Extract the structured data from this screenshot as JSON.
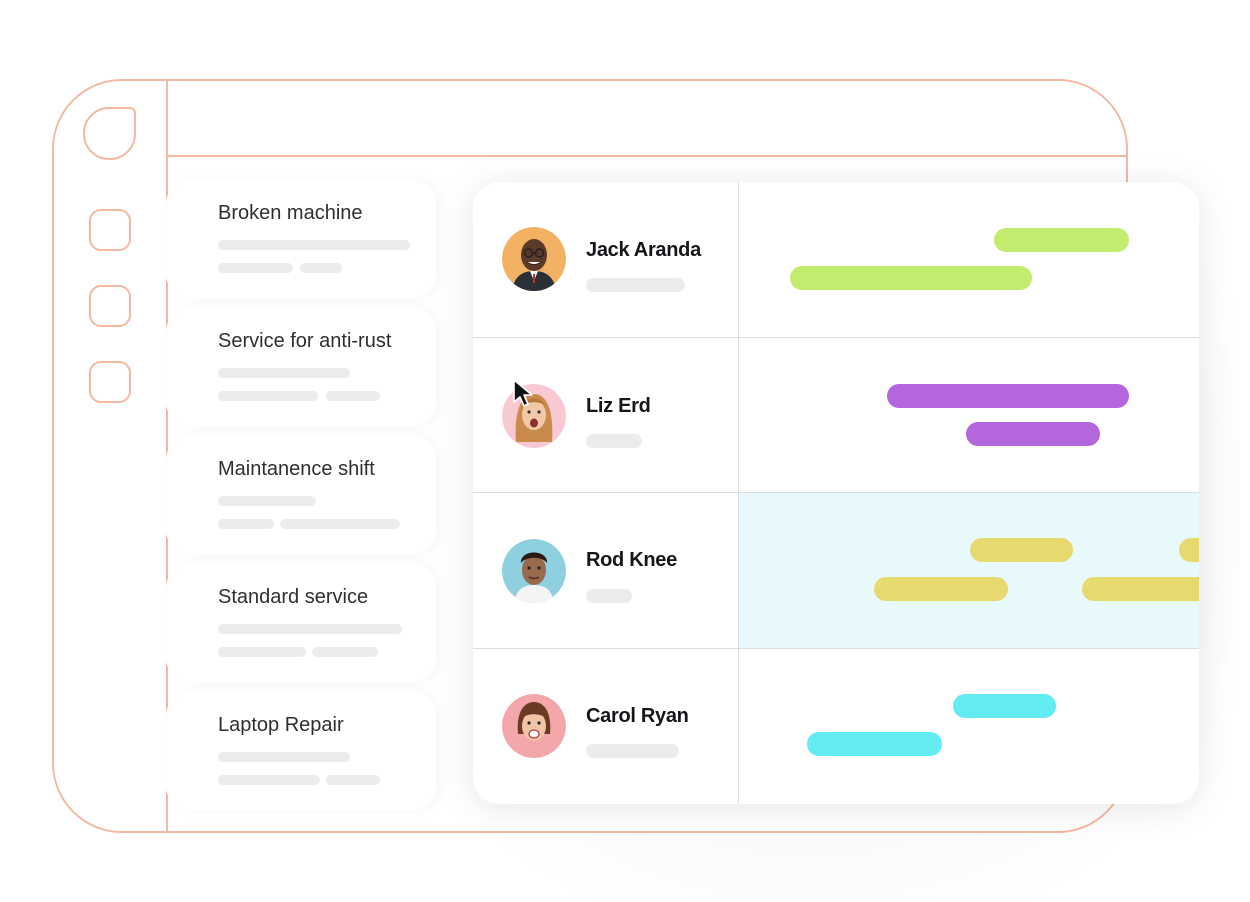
{
  "tasks": [
    {
      "title": "Broken machine"
    },
    {
      "title": "Service for anti-rust"
    },
    {
      "title": "Maintanence shift"
    },
    {
      "title": "Standard service"
    },
    {
      "title": "Laptop Repair"
    }
  ],
  "people": [
    {
      "name": "Jack Aranda",
      "color": "#c2ec6e",
      "avatar_bg": "#f3b163",
      "skin": "#5b3a29"
    },
    {
      "name": "Liz Erd",
      "color": "#b466dc",
      "avatar_bg": "#f8c9d2",
      "skin": "#f2c9a8"
    },
    {
      "name": "Rod Knee",
      "color": "#e6da6e",
      "avatar_bg": "#8ecfe0",
      "skin": "#9a6a4e"
    },
    {
      "name": "Carol Ryan",
      "color": "#62ebf0",
      "avatar_bg": "#f3a7aa",
      "skin": "#f0c4a4"
    }
  ],
  "colors": {
    "frame_stroke": "#f2b9a0",
    "highlight_row": "#e8f9fb",
    "skeleton": "#ececee"
  }
}
